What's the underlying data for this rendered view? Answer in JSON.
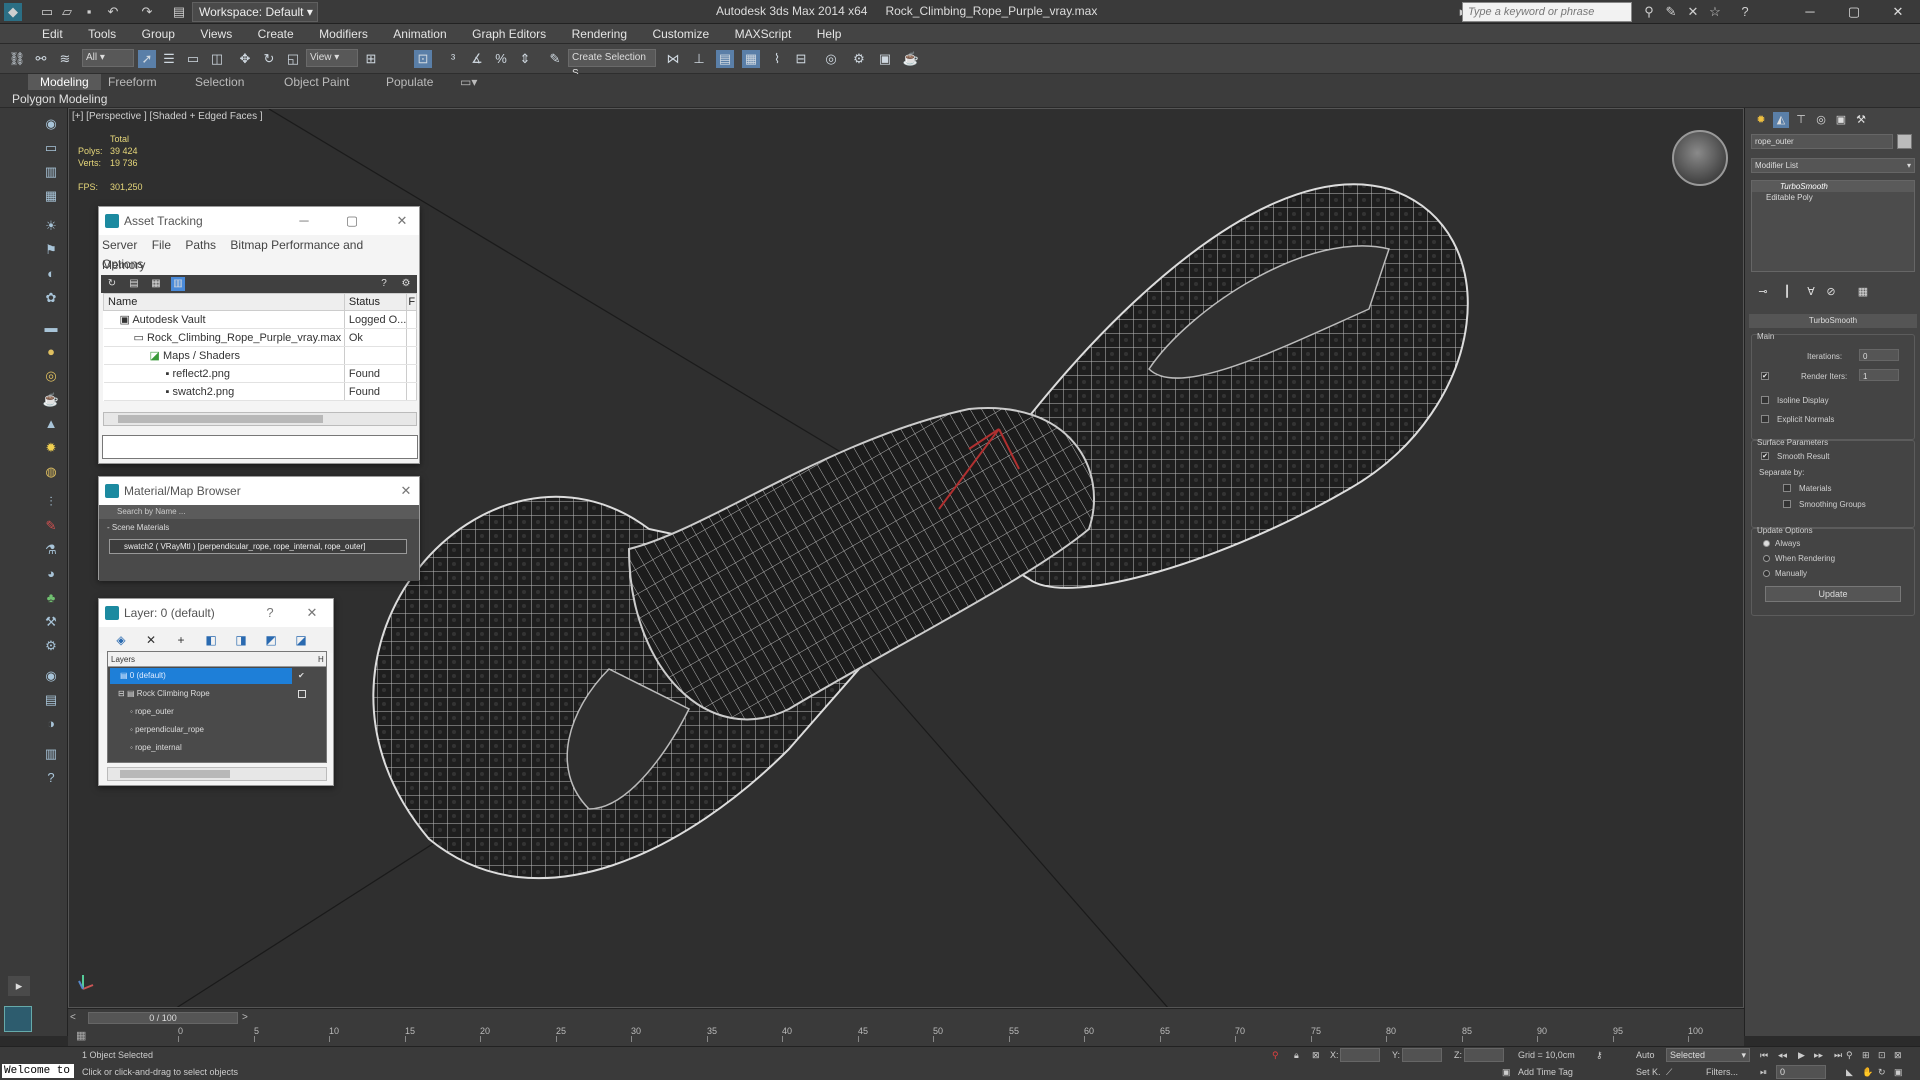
{
  "app": {
    "title": "Autodesk 3ds Max  2014 x64",
    "filename": "Rock_Climbing_Rope_Purple_vray.max",
    "workspace": "Workspace: Default",
    "search_placeholder": "Type a keyword or phrase"
  },
  "menu": [
    "Edit",
    "Tools",
    "Group",
    "Views",
    "Create",
    "Modifiers",
    "Animation",
    "Graph Editors",
    "Rendering",
    "Customize",
    "MAXScript",
    "Help"
  ],
  "toolbar": {
    "filter_select": "All",
    "ref_coord": "View",
    "named_selection": "Create Selection S"
  },
  "ribbon": {
    "tabs": [
      "Modeling",
      "Freeform",
      "Selection",
      "Object Paint",
      "Populate"
    ],
    "active_tab": "Modeling",
    "sub": "Polygon Modeling"
  },
  "viewport": {
    "label": "[+] [Perspective ] [Shaded + Edged Faces ]",
    "stats_total": "Total",
    "polys_label": "Polys:",
    "polys": "39 424",
    "verts_label": "Verts:",
    "verts": "19 736",
    "fps_label": "FPS:",
    "fps": "301,250"
  },
  "asset_tracking": {
    "title": "Asset Tracking",
    "menu": [
      "Server",
      "File",
      "Paths",
      "Bitmap Performance and Memory"
    ],
    "options": "Options",
    "col_name": "Name",
    "col_status": "Status",
    "col_extra": "F",
    "rows": [
      {
        "name": "Autodesk Vault",
        "status": "Logged O..."
      },
      {
        "name": "Rock_Climbing_Rope_Purple_vray.max",
        "status": "Ok"
      },
      {
        "name": "Maps / Shaders",
        "status": ""
      },
      {
        "name": "reflect2.png",
        "status": "Found"
      },
      {
        "name": "swatch2.png",
        "status": "Found"
      }
    ]
  },
  "material_browser": {
    "title": "Material/Map Browser",
    "search": "Search by Name ...",
    "section": "- Scene Materials",
    "item": "swatch2  ( VRayMtl ) [perpendicular_rope, rope_internal, rope_outer]"
  },
  "layer_window": {
    "title": "Layer: 0 (default)",
    "help": "?",
    "header": "Layers",
    "header_col": "H",
    "rows": [
      {
        "name": "0 (default)"
      },
      {
        "name": "Rock Climbing Rope"
      },
      {
        "name": "rope_outer"
      },
      {
        "name": "perpendicular_rope"
      },
      {
        "name": "rope_internal"
      }
    ]
  },
  "command_panel": {
    "object_name": "rope_outer",
    "modifier_list": "Modifier List",
    "stack": [
      "TurboSmooth",
      "Editable Poly"
    ],
    "rollout_title": "TurboSmooth",
    "main": "Main",
    "iterations_label": "Iterations:",
    "iterations": "0",
    "render_iters_label": "Render Iters:",
    "render_iters": "1",
    "isoline": "Isoline Display",
    "explicit_normals": "Explicit Normals",
    "surface_params": "Surface Parameters",
    "smooth_result": "Smooth Result",
    "separate_by": "Separate by:",
    "materials": "Materials",
    "smoothing_groups": "Smoothing Groups",
    "update_options": "Update Options",
    "always": "Always",
    "when_rendering": "When Rendering",
    "manually": "Manually",
    "update_button": "Update"
  },
  "timeline": {
    "frame": "0 / 100",
    "ticks": [
      "0",
      "5",
      "10",
      "15",
      "20",
      "25",
      "30",
      "35",
      "40",
      "45",
      "50",
      "55",
      "60",
      "65",
      "70",
      "75",
      "80",
      "85",
      "90",
      "95",
      "100"
    ]
  },
  "status": {
    "welcome": "Welcome to",
    "selected": "1 Object Selected",
    "prompt": "Click or click-and-drag to select objects",
    "x_label": "X:",
    "y_label": "Y:",
    "z_label": "Z:",
    "grid": "Grid = 10,0cm",
    "add_time_tag": "Add Time Tag",
    "auto": "Auto",
    "selected_mode": "Selected",
    "set_key": "Set K.",
    "filters": "Filters...",
    "current_frame": "0"
  }
}
